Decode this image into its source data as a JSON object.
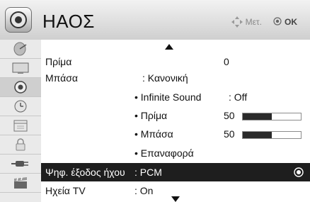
{
  "header": {
    "title": "ΗΑΟΣ",
    "move_hint": "Μετ.",
    "ok_hint": "OK",
    "icon": "speaker-icon"
  },
  "sidebar": {
    "items": [
      {
        "icon": "satellite-dish-icon"
      },
      {
        "icon": "monitor-icon"
      },
      {
        "icon": "speaker-icon",
        "active": true
      },
      {
        "icon": "clock-icon"
      },
      {
        "icon": "calendar-icon"
      },
      {
        "icon": "lock-icon"
      },
      {
        "icon": "plug-icon"
      },
      {
        "icon": "clapperboard-icon"
      }
    ]
  },
  "menu": {
    "treble": {
      "label": "Πρίμα",
      "value": "0"
    },
    "bass": {
      "label": "Μπάσα",
      "value": ": Κανονική"
    },
    "infinite_sound": {
      "label": "Infinite Sound",
      "value": ": Off"
    },
    "sub_treble": {
      "label": "Πρίμα",
      "value": "50",
      "level": 0.5
    },
    "sub_bass": {
      "label": "Μπάσα",
      "value": "50",
      "level": 0.5
    },
    "reset": {
      "label": "Επαναφορά"
    },
    "digital_out": {
      "label": "Ψηφ. έξοδος ήχου",
      "value": ": PCM"
    },
    "tv_speakers": {
      "label": "Ηχεία TV",
      "value": ": On"
    }
  },
  "colors": {
    "selected_row": "#1e1e1e",
    "bar_fill": "#2a2a2a"
  }
}
